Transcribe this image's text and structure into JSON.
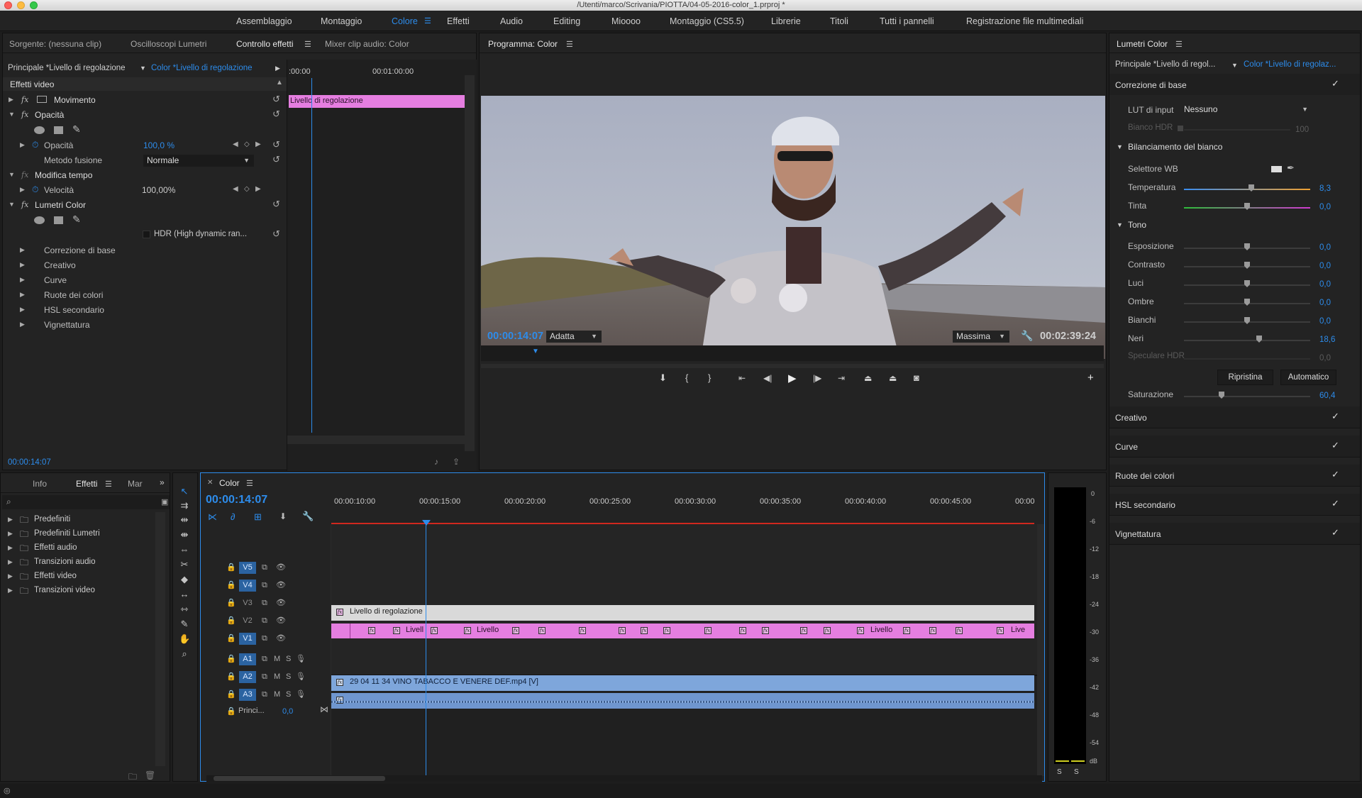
{
  "window": {
    "title": "/Utenti/marco/Scrivania/PIOTTA/04-05-2016-color_1.prproj *"
  },
  "workspaces": [
    "Assemblaggio",
    "Montaggio",
    "Colore",
    "Effetti",
    "Audio",
    "Editing",
    "Mioooo",
    "Montaggio (CS5.5)",
    "Librerie",
    "Titoli",
    "Tutti i pannelli",
    "Registrazione file multimediali"
  ],
  "active_workspace": "Colore",
  "source_panel": {
    "tabs": [
      "Sorgente: (nessuna clip)",
      "Oscilloscopi Lumetri",
      "Controllo effetti",
      "Mixer clip audio: Color"
    ],
    "breadcrumb_master": "Principale *Livello di regolazione",
    "breadcrumb_seq": "Color *Livello di regolazione",
    "ruler_start": ":00:00",
    "ruler_mid": "00:01:00:00",
    "clip_label": "Livello di regolazione",
    "section": "Effetti video",
    "movimento": "Movimento",
    "opacita_group": "Opacità",
    "opacita_label": "Opacità",
    "opacita_value": "100,0 %",
    "metodo_label": "Metodo fusione",
    "metodo_value": "Normale",
    "modifica_tempo": "Modifica tempo",
    "velocita_label": "Velocità",
    "velocita_value": "100,00%",
    "lumetri": "Lumetri Color",
    "hdr": "HDR (High dynamic ran...",
    "sub": [
      "Correzione di base",
      "Creativo",
      "Curve",
      "Ruote dei colori",
      "HSL secondario",
      "Vignettatura"
    ],
    "timecode": "00:00:14:07"
  },
  "program": {
    "title": "Programma: Color",
    "timecode": "00:00:14:07",
    "fit": "Adatta",
    "quality": "Massima",
    "duration": "00:02:39:24"
  },
  "lumetri": {
    "title": "Lumetri Color",
    "master": "Principale *Livello di regol...",
    "seq": "Color *Livello di regolaz...",
    "basic": "Correzione di base",
    "lut_label": "LUT di input",
    "lut_value": "Nessuno",
    "hdr_label": "Bianco HDR",
    "hdr_value": "100",
    "wb_title": "Bilanciamento del bianco",
    "wb_selector": "Selettore WB",
    "temp_label": "Temperatura",
    "temp_value": "8,3",
    "tint_label": "Tinta",
    "tint_value": "0,0",
    "tone_title": "Tono",
    "tone": [
      {
        "label": "Esposizione",
        "value": "0,0"
      },
      {
        "label": "Contrasto",
        "value": "0,0"
      },
      {
        "label": "Luci",
        "value": "0,0"
      },
      {
        "label": "Ombre",
        "value": "0,0"
      },
      {
        "label": "Bianchi",
        "value": "0,0"
      },
      {
        "label": "Neri",
        "value": "18,6"
      }
    ],
    "spec_label": "Speculare HDR",
    "spec_value": "0,0",
    "reset_btn": "Ripristina",
    "auto_btn": "Automatico",
    "sat_label": "Saturazione",
    "sat_value": "60,4",
    "sections": [
      "Creativo",
      "Curve",
      "Ruote dei colori",
      "HSL secondario",
      "Vignettatura"
    ]
  },
  "effects_panel": {
    "tabs": [
      "Info",
      "Effetti",
      "Mar"
    ],
    "items": [
      "Predefiniti",
      "Predefiniti Lumetri",
      "Effetti audio",
      "Transizioni audio",
      "Effetti video",
      "Transizioni video"
    ]
  },
  "timeline": {
    "name": "Color",
    "timecode": "00:00:14:07",
    "ruler": [
      "00:00:10:00",
      "00:00:15:00",
      "00:00:20:00",
      "00:00:25:00",
      "00:00:30:00",
      "00:00:35:00",
      "00:00:40:00",
      "00:00:45:00",
      "00:00"
    ],
    "tracks": [
      "V5",
      "V4",
      "V3",
      "V2",
      "V1",
      "A1",
      "A2",
      "A3"
    ],
    "master_label": "Princi...",
    "master_value": "0,0",
    "v5_clip": "Livello di regolazione",
    "v4_clip": "Livello",
    "v4_clip_short": "Livell",
    "v4_clip_tail": "Live",
    "v1_clip": "29 04 11 34 VINO TABACCO E VENERE DEF.mp4 [V]"
  },
  "meter": {
    "labels": [
      "0",
      "-6",
      "-12",
      "-18",
      "-24",
      "-30",
      "-36",
      "-42",
      "-48",
      "-54",
      "dB"
    ],
    "solo": [
      "S",
      "S"
    ]
  }
}
